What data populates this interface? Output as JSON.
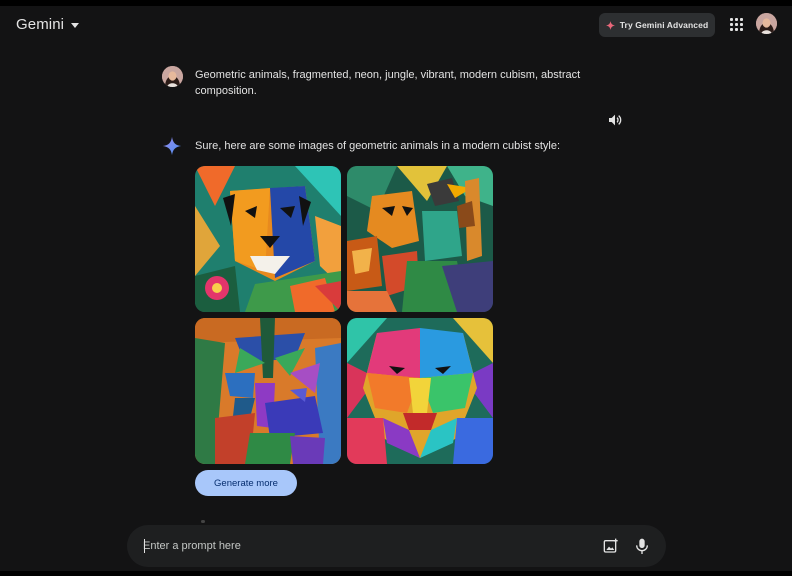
{
  "header": {
    "app_name": "Gemini",
    "app_menu_icon": "caret-down-icon",
    "upgrade_button_label": "Try Gemini Advanced",
    "upgrade_icon": "sparkle-icon",
    "apps_icon": "apps-grid-icon",
    "account_icon": "user-avatar"
  },
  "conversation": {
    "user_prompt": "Geometric animals, fragmented, neon, jungle, vibrant, modern cubism, abstract composition.",
    "read_aloud_icon": "speaker-icon",
    "assistant_icon": "gemini-sparkle-icon",
    "assistant_reply": "Sure, here are some images of geometric animals in a modern cubist style:",
    "images": [
      {
        "subject": "cubist tiger with pink flower"
      },
      {
        "subject": "cubist lion, giraffe and toucan"
      },
      {
        "subject": "cubist jungle with blue beast"
      },
      {
        "subject": "cubist neon lion face"
      }
    ],
    "generate_more_label": "Generate more"
  },
  "composer": {
    "placeholder": "Enter a prompt here",
    "value": "",
    "image_upload_icon": "add-image-icon",
    "mic_icon": "microphone-icon"
  },
  "colors": {
    "background": "#131314",
    "surface": "#1e1f20",
    "accent_button": "#a8c7fa",
    "text": "#e3e3e3"
  }
}
